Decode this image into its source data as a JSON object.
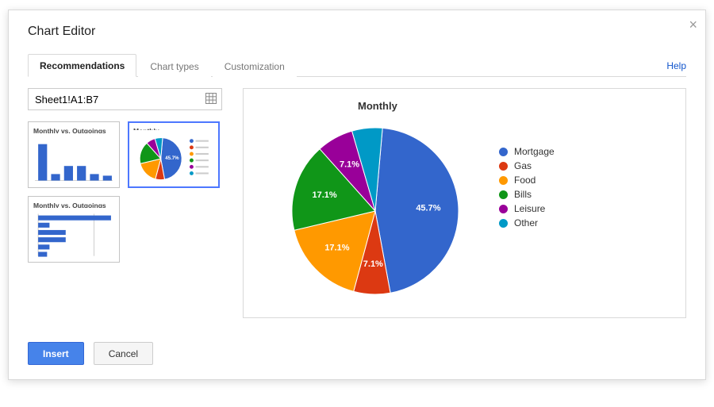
{
  "dialog": {
    "title": "Chart Editor",
    "tabs": [
      {
        "label": "Recommendations",
        "active": true
      },
      {
        "label": "Chart types",
        "active": false
      },
      {
        "label": "Customization",
        "active": false
      }
    ],
    "help_label": "Help",
    "range_value": "Sheet1!A1:B7",
    "thumbs": {
      "bar_title": "Monthly vs. Outgoings",
      "pie_title": "Monthly",
      "hbar_title": "Monthly vs. Outgoings"
    },
    "buttons": {
      "insert": "Insert",
      "cancel": "Cancel"
    }
  },
  "chart_data": {
    "type": "pie",
    "title": "Monthly",
    "series": [
      {
        "name": "Mortgage",
        "value": 45.7,
        "label": "45.7%",
        "color": "#3366cc"
      },
      {
        "name": "Gas",
        "value": 7.1,
        "label": "7.1%",
        "color": "#dc3912"
      },
      {
        "name": "Food",
        "value": 17.1,
        "label": "17.1%",
        "color": "#ff9900"
      },
      {
        "name": "Bills",
        "value": 17.1,
        "label": "17.1%",
        "color": "#109618"
      },
      {
        "name": "Leisure",
        "value": 7.1,
        "label": "7.1%",
        "color": "#990099"
      },
      {
        "name": "Other",
        "value": 5.9,
        "label": "",
        "color": "#0099c6"
      }
    ]
  }
}
